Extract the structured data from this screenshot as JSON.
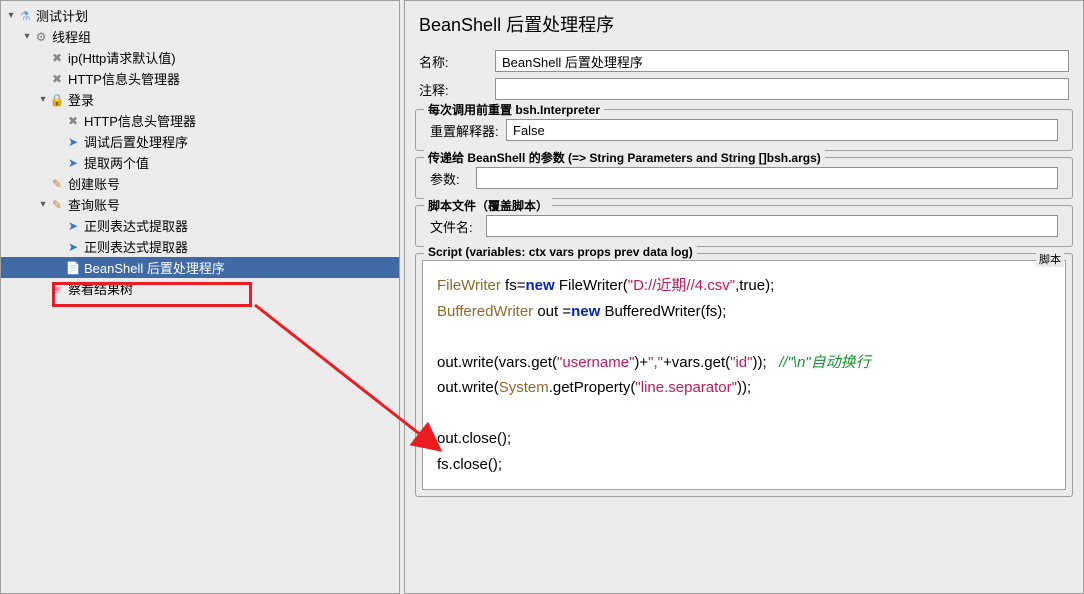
{
  "tree": {
    "root": "测试计划",
    "thread_group": "线程组",
    "ip_defaults": "ip(Http请求默认值)",
    "http_header_mgr": "HTTP信息头管理器",
    "login": "登录",
    "http_header_mgr2": "HTTP信息头管理器",
    "debug_post": "调试后置处理程序",
    "extract_two": "提取两个值",
    "create_account": "创建账号",
    "query_account": "查询账号",
    "regex_extractor1": "正则表达式提取器",
    "regex_extractor2": "正则表达式提取器",
    "beanshell_post": "BeanShell 后置处理程序",
    "view_results": "察看结果树"
  },
  "panel": {
    "title": "BeanShell 后置处理程序",
    "name_label": "名称:",
    "name_value": "BeanShell 后置处理程序",
    "comment_label": "注释:",
    "comment_value": ""
  },
  "section1": {
    "title": "每次调用前重置 bsh.Interpreter",
    "reset_label": "重置解释器:",
    "reset_value": "False"
  },
  "section2": {
    "title": "传递给 BeanShell 的参数 (=> String Parameters and String []bsh.args)",
    "params_label": "参数:",
    "params_value": ""
  },
  "section3": {
    "title": "脚本文件（覆盖脚本）",
    "filename_label": "文件名:",
    "filename_value": ""
  },
  "section4": {
    "title": "Script (variables: ctx vars props prev data log)",
    "corner_label": "脚本"
  },
  "script": {
    "l1_a": "FileWriter",
    "l1_b": " fs=",
    "l1_c": "new",
    "l1_d": " FileWriter(",
    "l1_e": "\"D://近期//4.csv\"",
    "l1_f": ",true);",
    "l2_a": "BufferedWriter",
    "l2_b": " out =",
    "l2_c": "new",
    "l2_d": " BufferedWriter(fs);",
    "l3_a": "out.write(vars.get(",
    "l3_b": "\"username\"",
    "l3_c": ")+",
    "l3_d": "\",\"",
    "l3_e": "+vars.get(",
    "l3_f": "\"id\"",
    "l3_g": "));",
    "l3_comment": "//\"\\n\"自动换行",
    "l4_a": "out.write(",
    "l4_b": "System",
    "l4_c": ".getProperty(",
    "l4_d": "\"line.separator\"",
    "l4_e": "));",
    "l5": "out.close();",
    "l6": "fs.close();"
  }
}
